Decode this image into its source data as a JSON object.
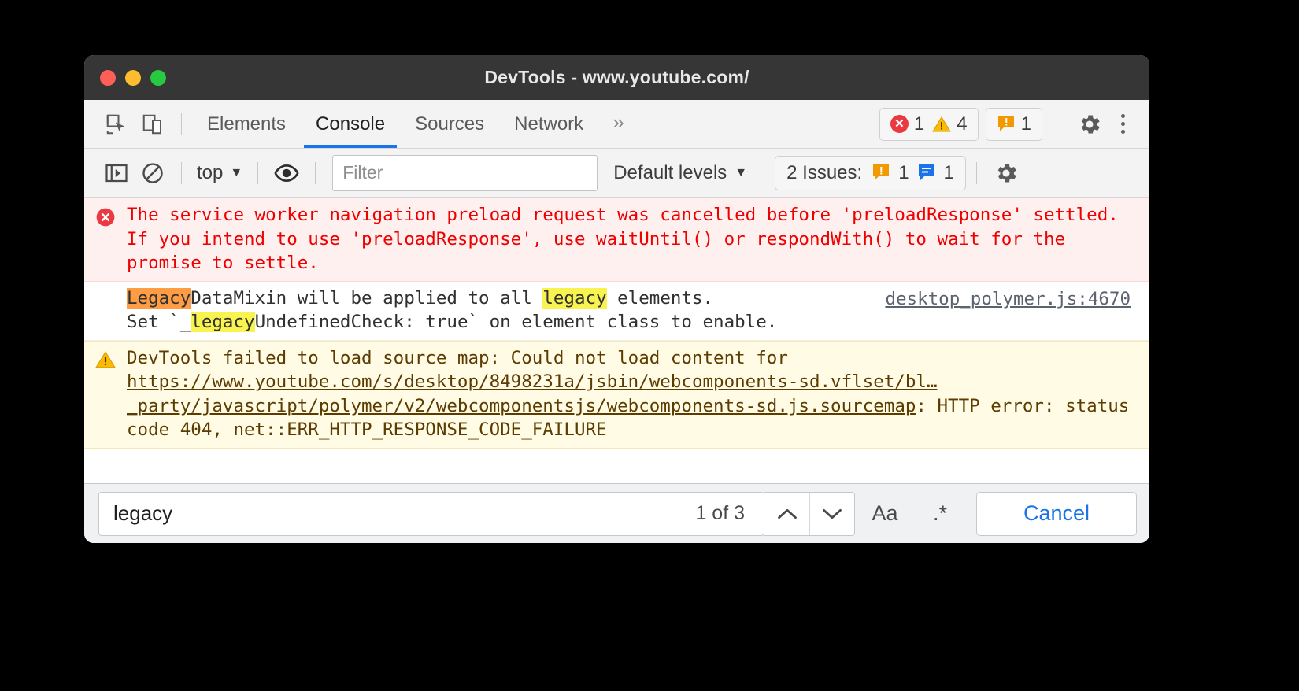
{
  "window": {
    "title": "DevTools - www.youtube.com/"
  },
  "tabbar": {
    "inspect_icon": "inspect-cursor-icon",
    "device_icon": "device-toolbar-icon",
    "tabs": [
      {
        "label": "Elements",
        "selected": false
      },
      {
        "label": "Console",
        "selected": true
      },
      {
        "label": "Sources",
        "selected": false
      },
      {
        "label": "Network",
        "selected": false
      }
    ],
    "more_tabs": "»",
    "error_count": "1",
    "warning_count": "4",
    "issue_count": "1",
    "settings_icon": "gear-icon",
    "menu_icon": "kebab-menu-icon"
  },
  "console_toolbar": {
    "sidebar_icon": "console-sidebar-icon",
    "clear_icon": "clear-console-icon",
    "context": "top",
    "context_caret": "▼",
    "eye_icon": "live-expression-eye-icon",
    "filter_placeholder": "Filter",
    "filter_value": "",
    "levels": "Default levels",
    "levels_caret": "▼",
    "issues_label": "2 Issues:",
    "issues_orange_count": "1",
    "issues_blue_count": "1",
    "settings_icon": "console-settings-gear-icon"
  },
  "messages": [
    {
      "type": "error",
      "icon": "error-circle-icon",
      "text": "The service worker navigation preload request was cancelled before 'preloadResponse' settled. If you intend to use 'preloadResponse', use waitUntil() or respondWith() to wait for the promise to settle.",
      "source": ""
    },
    {
      "type": "info",
      "icon": "",
      "line1_pre": "",
      "line1_match_active": "Legacy",
      "line1_mid": "DataMixin will be applied to all ",
      "line1_match2": "legacy",
      "line1_post": " elements.",
      "line2_pre": "Set `_",
      "line2_match": "legacy",
      "line2_post": "UndefinedCheck: true` on element class to enable.",
      "source": "desktop_polymer.js:4670"
    },
    {
      "type": "warning",
      "icon": "warning-triangle-icon",
      "prefix": "DevTools failed to load source map: Could not load content for ",
      "url": "https://www.youtube.com/s/desktop/8498231a/jsbin/webcomponents-sd.vflset/bl…_party/javascript/polymer/v2/webcomponentsjs/webcomponents-sd.js.sourcemap",
      "suffix": ": HTTP error: status code 404, net::ERR_HTTP_RESPONSE_CODE_FAILURE"
    }
  ],
  "search_bar": {
    "query": "legacy",
    "matches": "1 of 3",
    "prev_icon": "chevron-up-icon",
    "next_icon": "chevron-down-icon",
    "match_case_label": "Aa",
    "regex_label": ".*",
    "cancel_label": "Cancel"
  },
  "colors": {
    "accent": "#1a73e8",
    "error": "#ef0000",
    "error_bg": "#fff0f0",
    "warning_bg": "#fffbe5",
    "warning_text": "#5c3c00",
    "highlight": "#f8f34f",
    "highlight_active": "#ff9c44",
    "titlebar": "#363636"
  }
}
